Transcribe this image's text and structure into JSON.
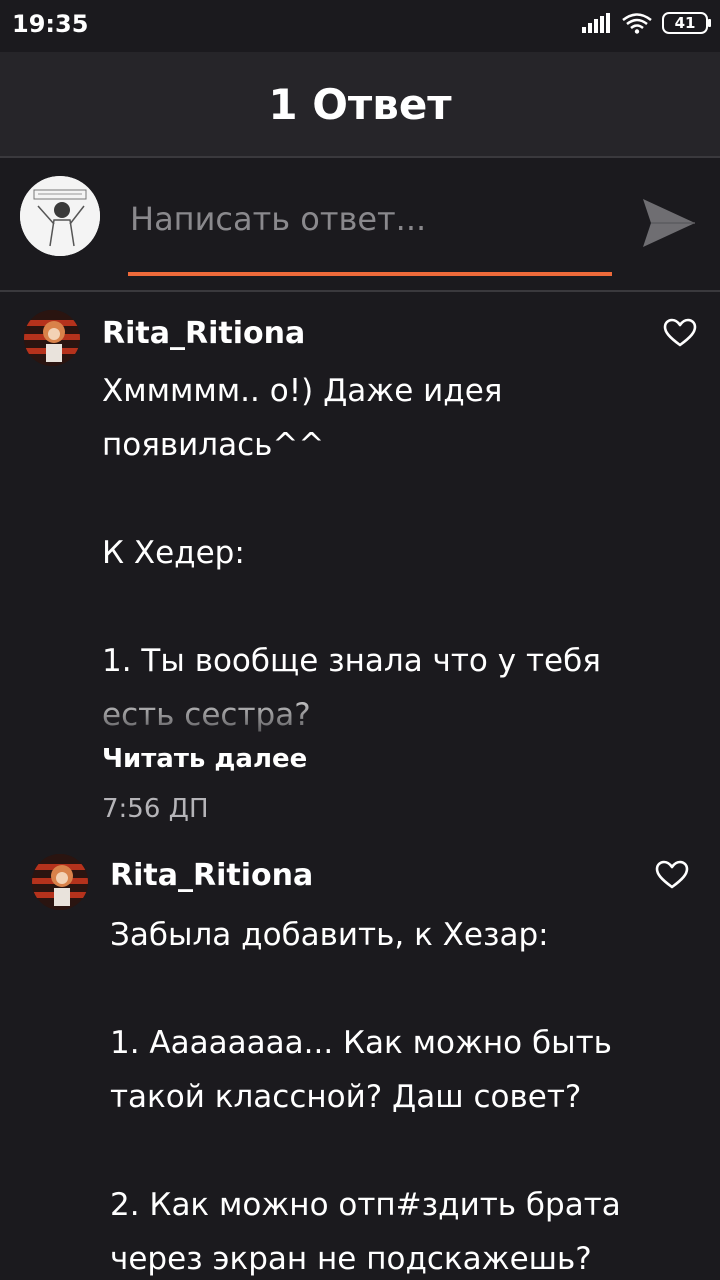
{
  "status": {
    "time": "19:35",
    "battery": "41"
  },
  "header": {
    "title": "1 Ответ"
  },
  "reply": {
    "placeholder": "Написать ответ..."
  },
  "comments": [
    {
      "author": "Rita_Ritiona",
      "text": "Хммммм.. о!) Даже идея\nпоявилась^^\n\nК Хедер:\n\n1. Ты вообще знала что у тебя\nесть сестра?",
      "read_more": "Читать далее",
      "time": "7:56 ДП"
    },
    {
      "author": "Rita_Ritiona",
      "text": "Забыла добавить, к Хезар:\n\n1. Ааааааaа... Как можно быть\nтакой классной? Даш совет?\n\n2. Как можно отп#здить брата\nчерез экран не подскажешь?"
    }
  ],
  "colors": {
    "accent": "#ee6a3a",
    "background": "#1b1a1e",
    "header": "#262529"
  },
  "icons": {
    "send": "send-icon",
    "like": "heart-outline-icon"
  }
}
